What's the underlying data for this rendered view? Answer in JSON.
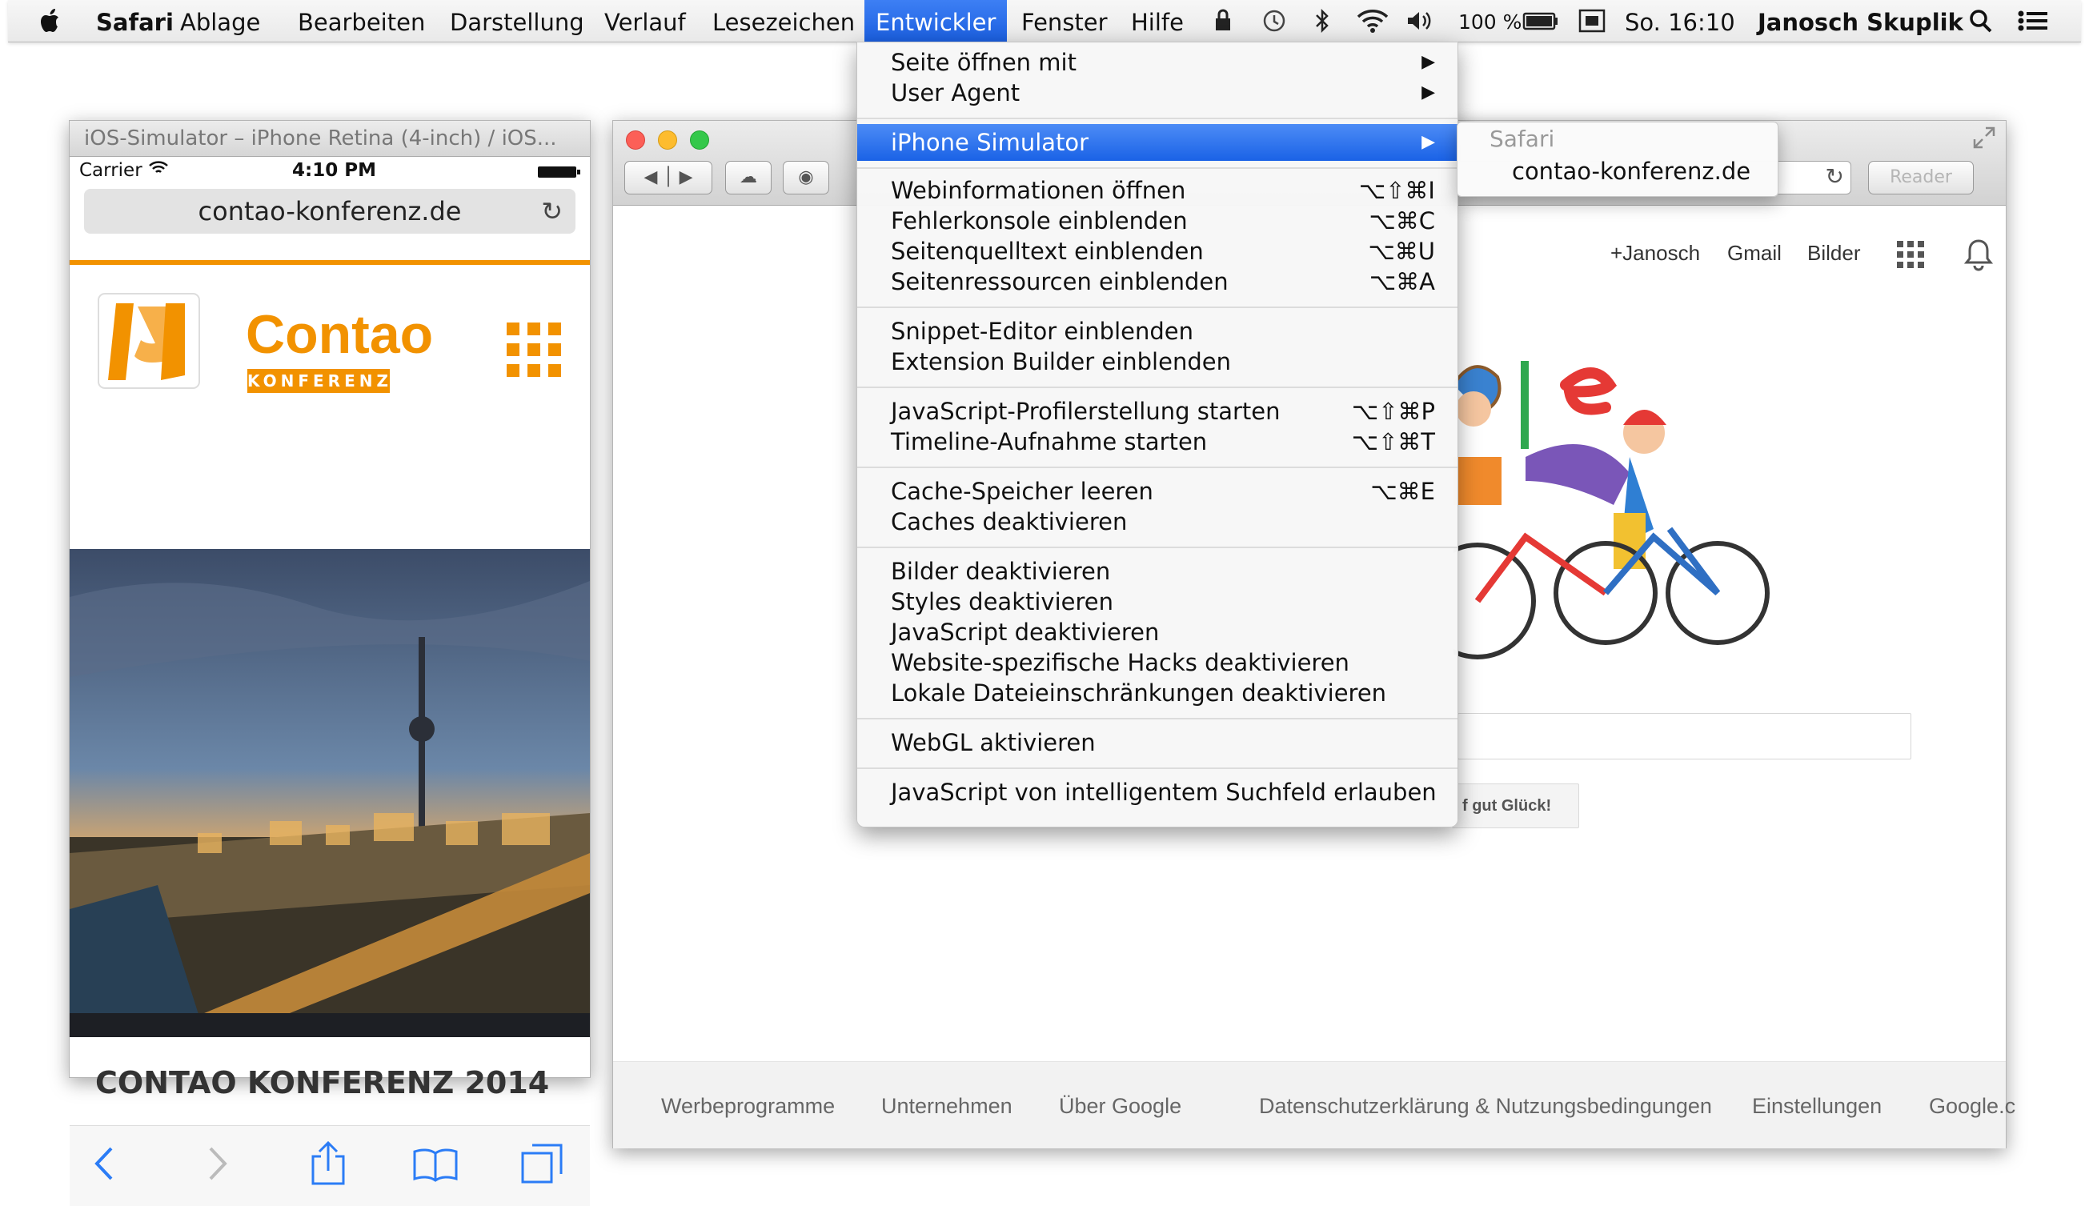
{
  "menubar": {
    "app": "Safari",
    "items": [
      "Ablage",
      "Bearbeiten",
      "Darstellung",
      "Verlauf",
      "Lesezeichen",
      "Entwickler",
      "Fenster",
      "Hilfe"
    ],
    "battery": "100 %",
    "clock": "So. 16:10",
    "user": "Janosch Skuplik"
  },
  "simulator": {
    "window_title": "iOS-Simulator – iPhone Retina (4-inch) / iOS...",
    "carrier": "Carrier",
    "time": "4:10 PM",
    "url": "contao-konferenz.de",
    "logo_text": "Contao",
    "logo_sub": "KONFERENZ",
    "headline": "CONTAO KONFERENZ 2014"
  },
  "browser": {
    "reader": "Reader",
    "top_links": [
      "+Janosch",
      "Gmail",
      "Bilder"
    ],
    "lucky_button": "f gut Glück!",
    "footer_links": [
      "Werbeprogramme",
      "Unternehmen",
      "Über Google",
      "Datenschutzerklärung & Nutzungsbedingungen",
      "Einstellungen",
      "Google.c"
    ]
  },
  "devmenu": {
    "items": [
      {
        "label": "Seite öffnen mit",
        "shortcut": "",
        "submenu": true
      },
      {
        "label": "User Agent",
        "shortcut": "",
        "submenu": true
      },
      {
        "label": "iPhone Simulator",
        "shortcut": "",
        "submenu": true,
        "highlighted": true
      },
      {
        "label": "Webinformationen öffnen",
        "shortcut": "⌥⇧⌘I"
      },
      {
        "label": "Fehlerkonsole einblenden",
        "shortcut": "⌥⌘C"
      },
      {
        "label": "Seitenquelltext einblenden",
        "shortcut": "⌥⌘U"
      },
      {
        "label": "Seitenressourcen einblenden",
        "shortcut": "⌥⌘A"
      },
      {
        "label": "Snippet-Editor einblenden",
        "shortcut": ""
      },
      {
        "label": "Extension Builder einblenden",
        "shortcut": ""
      },
      {
        "label": "JavaScript-Profilerstellung starten",
        "shortcut": "⌥⇧⌘P"
      },
      {
        "label": "Timeline-Aufnahme starten",
        "shortcut": "⌥⇧⌘T"
      },
      {
        "label": "Cache-Speicher leeren",
        "shortcut": "⌥⌘E"
      },
      {
        "label": "Caches deaktivieren",
        "shortcut": ""
      },
      {
        "label": "Bilder deaktivieren",
        "shortcut": ""
      },
      {
        "label": "Styles deaktivieren",
        "shortcut": ""
      },
      {
        "label": "JavaScript deaktivieren",
        "shortcut": ""
      },
      {
        "label": "Website-spezifische Hacks deaktivieren",
        "shortcut": ""
      },
      {
        "label": "Lokale Dateieinschränkungen deaktivieren",
        "shortcut": ""
      },
      {
        "label": "WebGL aktivieren",
        "shortcut": ""
      },
      {
        "label": "JavaScript von intelligentem Suchfeld erlauben",
        "shortcut": ""
      }
    ]
  },
  "submenu": {
    "header": "Safari",
    "item": "contao-konferenz.de"
  },
  "colors": {
    "menu_highlight": "#1a62e6",
    "contao_orange": "#f29200",
    "traffic_red": "#fc5f57",
    "traffic_yellow": "#fdbc2e",
    "traffic_green": "#34c84a"
  }
}
